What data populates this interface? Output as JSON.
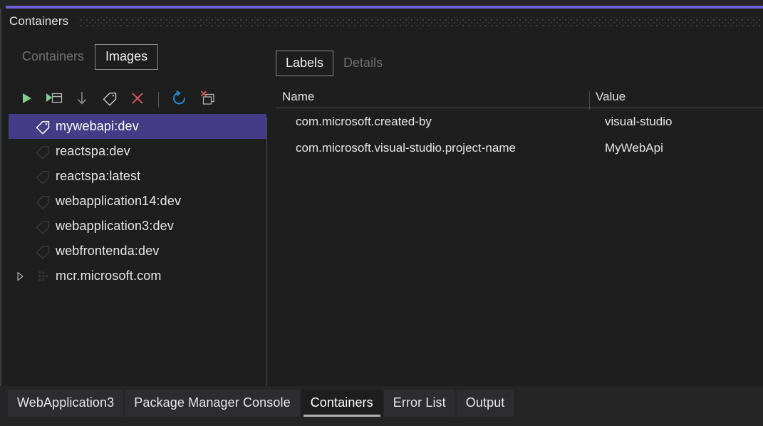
{
  "window": {
    "title": "Containers",
    "accent_color": "#6b5fd4",
    "background": "#1e1e1e"
  },
  "inner_tabs": [
    {
      "label": "Containers",
      "active": false
    },
    {
      "label": "Images",
      "active": true
    }
  ],
  "toolbar": {
    "buttons": [
      {
        "name": "run-icon",
        "tooltip": "Run"
      },
      {
        "name": "run-interactive-icon",
        "tooltip": "Run Interactive"
      },
      {
        "name": "pull-icon",
        "tooltip": "Pull"
      },
      {
        "name": "tag-icon",
        "tooltip": "Tag"
      },
      {
        "name": "remove-icon",
        "tooltip": "Remove"
      },
      {
        "name": "separator",
        "tooltip": ""
      },
      {
        "name": "refresh-icon",
        "tooltip": "Refresh"
      },
      {
        "name": "prune-icon",
        "tooltip": "Prune"
      }
    ],
    "colors": {
      "run_green": "#7fd18a",
      "remove_red": "#e05c5c",
      "refresh_blue": "#1e8ee0",
      "dim": "#8c8c8c"
    }
  },
  "image_list": {
    "selected_index": 0,
    "items": [
      {
        "label": "mywebapi:dev",
        "icon": "tag-icon",
        "expandable": false,
        "selected": true
      },
      {
        "label": "reactspa:dev",
        "icon": "tag-icon",
        "expandable": false,
        "selected": false
      },
      {
        "label": "reactspa:latest",
        "icon": "tag-icon",
        "expandable": false,
        "selected": false
      },
      {
        "label": "webapplication14:dev",
        "icon": "tag-icon",
        "expandable": false,
        "selected": false
      },
      {
        "label": "webapplication3:dev",
        "icon": "tag-icon",
        "expandable": false,
        "selected": false
      },
      {
        "label": "webfrontenda:dev",
        "icon": "tag-icon",
        "expandable": false,
        "selected": false
      },
      {
        "label": "mcr.microsoft.com",
        "icon": "registry-icon",
        "expandable": true,
        "selected": false
      }
    ]
  },
  "detail_tabs": [
    {
      "label": "Labels",
      "active": true
    },
    {
      "label": "Details",
      "active": false
    }
  ],
  "labels_grid": {
    "columns": [
      "Name",
      "Value"
    ],
    "rows": [
      {
        "name": "com.microsoft.created-by",
        "value": "visual-studio"
      },
      {
        "name": "com.microsoft.visual-studio.project-name",
        "value": "MyWebApi"
      }
    ]
  },
  "bottom_tabs": [
    {
      "label": "WebApplication3",
      "active": false
    },
    {
      "label": "Package Manager Console",
      "active": false
    },
    {
      "label": "Containers",
      "active": true
    },
    {
      "label": "Error List",
      "active": false
    },
    {
      "label": "Output",
      "active": false
    }
  ]
}
